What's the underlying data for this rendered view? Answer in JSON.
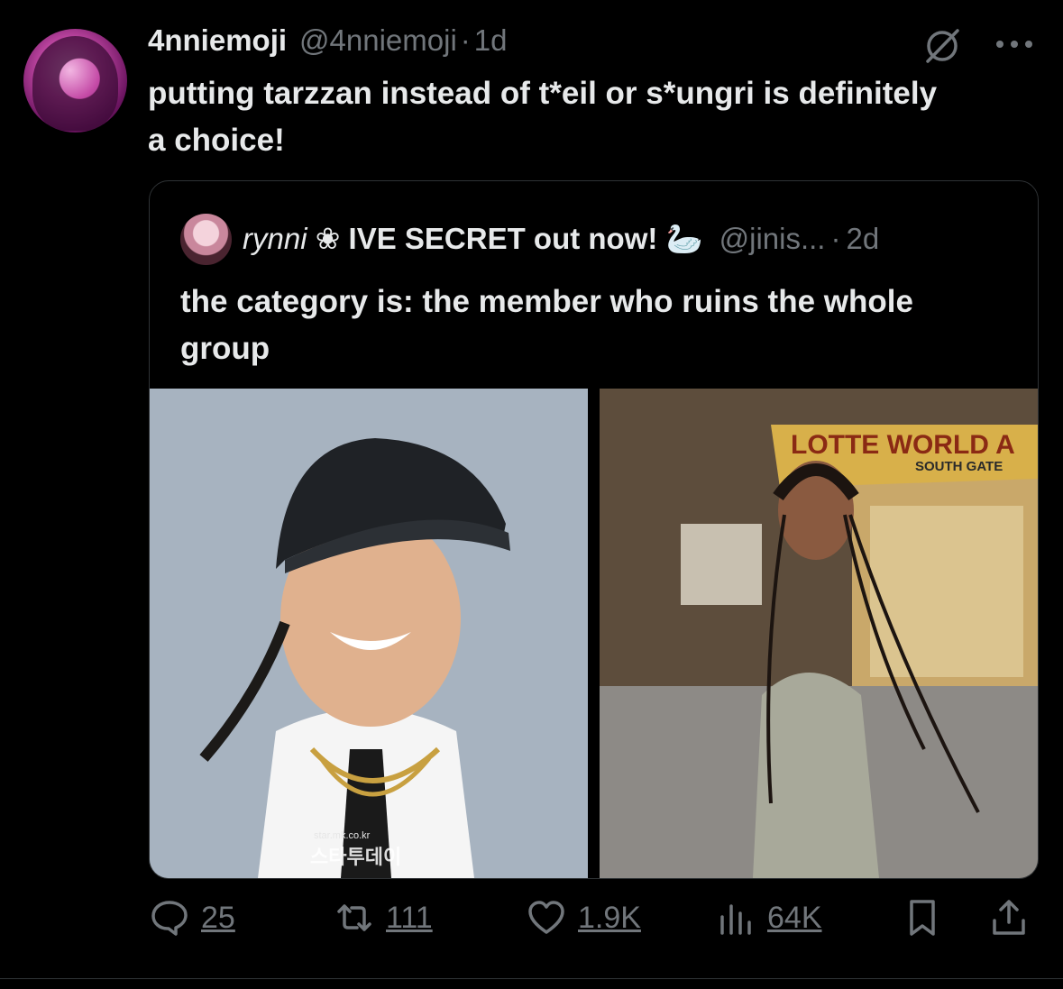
{
  "tweet": {
    "display_name": "4nniemoji",
    "handle": "@4nniemoji",
    "separator": "·",
    "time": "1d",
    "text": "putting tarzzan instead of t*eil or s*ungri is definitely a choice!"
  },
  "quoted_tweet": {
    "display_name_prefix": "rynni",
    "flower_glyph": "❀",
    "display_name_suffix": "IVE SECRET out now!",
    "swan_glyph": "🦢",
    "handle": "@jinis...",
    "separator": "·",
    "time": "2d",
    "text": "the category is: the member who ruins the whole group",
    "images": [
      {
        "watermark_top": "star.mk.co.kr",
        "watermark_main": "스타투데이"
      },
      {
        "sign_main": "LOTTE WORLD A",
        "sign_sub": "SOUTH GATE"
      }
    ]
  },
  "actions": {
    "replies": "25",
    "reposts": "111",
    "likes": "1.9K",
    "views": "64K"
  },
  "icons": [
    "grok-icon",
    "more-icon",
    "reply-icon",
    "repost-icon",
    "like-icon",
    "views-icon",
    "bookmark-icon",
    "share-icon"
  ],
  "colors": {
    "background": "#000000",
    "text": "#e7e9ea",
    "muted": "#71767b",
    "border": "#2f3336"
  }
}
